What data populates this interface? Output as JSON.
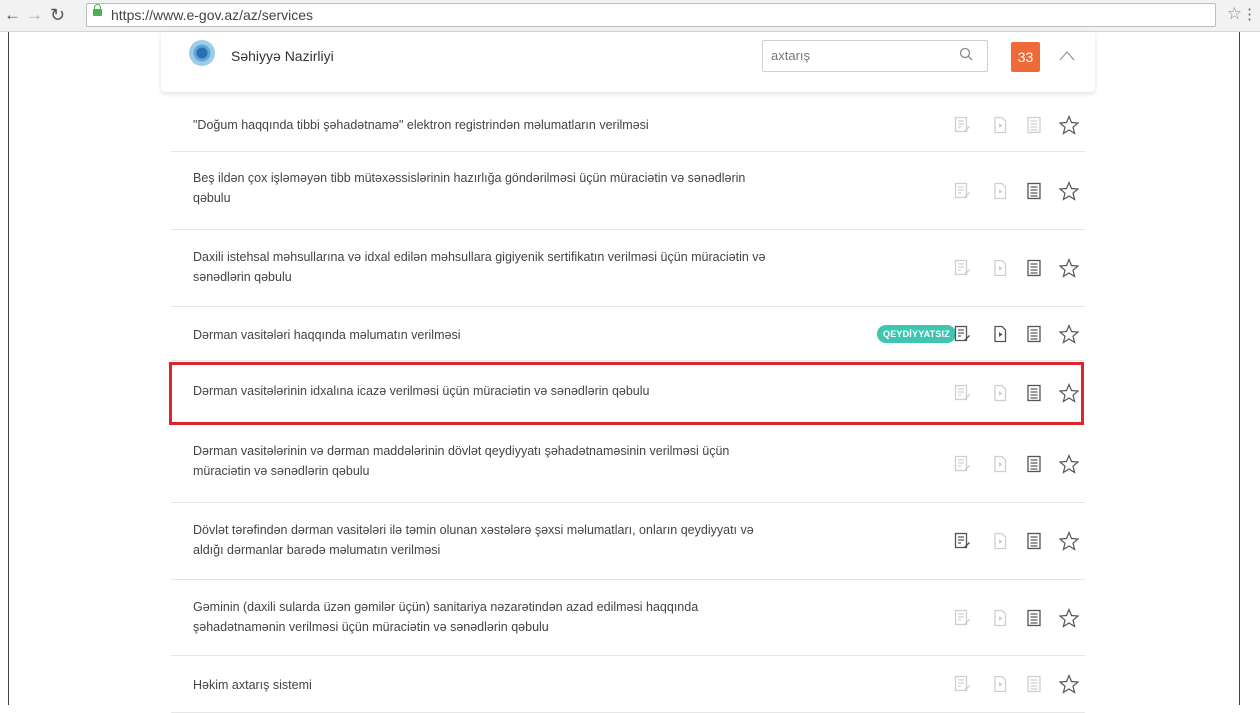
{
  "browser": {
    "url": "https://www.e-gov.az/az/services",
    "back_icon": "arrow-left-icon",
    "forward_icon": "arrow-right-icon",
    "reload_icon": "reload-icon",
    "lock_icon": "lock-icon"
  },
  "header": {
    "ministry": "Səhiyyə Nazirliyi",
    "search_placeholder": "axtarış",
    "count": "33"
  },
  "colors": {
    "badge": "#ee6a37",
    "qeydiyyatsiz": "#3ec6b1",
    "highlight": "#e0242c"
  },
  "services": [
    {
      "text": "\"Doğum haqqında tibbi şəhadətnamə\" elektron registrindən məlumatların verilməsi",
      "active": [
        false,
        false,
        false
      ]
    },
    {
      "text": "Beş ildən çox işləməyən tibb mütəxəssislərinin hazırlığa göndərilməsi üçün müraciətin və sənədlərin qəbulu",
      "active": [
        false,
        false,
        true
      ]
    },
    {
      "text": "Daxili istehsal məhsullarına və idxal edilən məhsullara gigiyenik sertifikatın verilməsi üçün müraciətin və sənədlərin qəbulu",
      "active": [
        false,
        false,
        true
      ]
    },
    {
      "text": "Dərman vasitələri haqqında məlumatın verilməsi",
      "badge": "QEYDİYYATSIZ",
      "active": [
        true,
        true,
        true
      ]
    },
    {
      "text": "Dərman vasitələrinin idxalına icazə verilməsi üçün müraciətin və sənədlərin qəbulu",
      "active": [
        false,
        false,
        true
      ]
    },
    {
      "text": "Dərman vasitələrinin və dərman maddələrinin dövlət qeydiyyatı şəhadətnaməsinin verilməsi üçün müraciətin və sənədlərin qəbulu",
      "active": [
        false,
        false,
        true
      ]
    },
    {
      "text": "Dövlət tərəfindən dərman vasitələri ilə təmin olunan xəstələrə şəxsi məlumatları, onların qeydiyyatı və aldığı dərmanlar barədə məlumatın verilməsi",
      "active": [
        true,
        false,
        true
      ]
    },
    {
      "text": "Gəminin (daxili sularda üzən gəmilər üçün) sanitariya nəzarətindən azad edilməsi haqqında şəhadətnamənin verilməsi üçün müraciətin və sənədlərin qəbulu",
      "active": [
        false,
        false,
        true
      ]
    },
    {
      "text": "Həkim axtarış sistemi",
      "active": [
        false,
        false,
        false
      ]
    }
  ]
}
